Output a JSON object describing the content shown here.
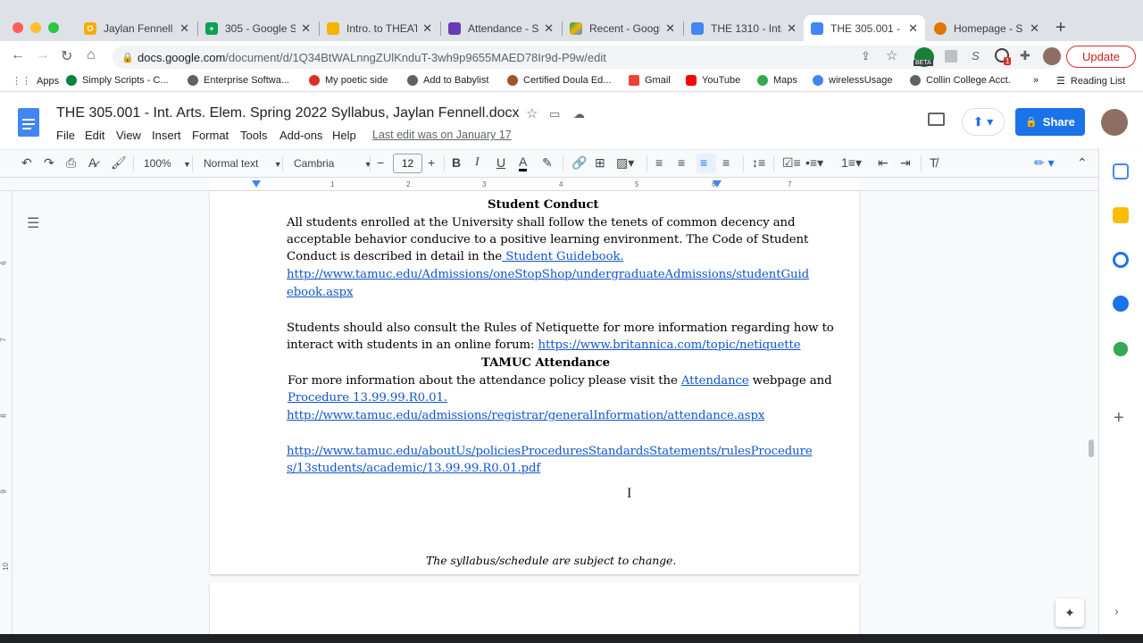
{
  "browser": {
    "tabs": [
      {
        "title": "Jaylan Fennell -",
        "color": "#f9ab00",
        "letter": "O"
      },
      {
        "title": "305 - Google S",
        "color": "#0f9d58",
        "letter": "+"
      },
      {
        "title": "Intro. to THEAT",
        "color": "#f4b400",
        "letter": ""
      },
      {
        "title": "Attendance - S",
        "color": "#673ab7",
        "letter": ""
      },
      {
        "title": "Recent - Googl",
        "color": "#4285f4",
        "letter": ""
      },
      {
        "title": "THE 1310 - Intr",
        "color": "#4285f4",
        "letter": ""
      },
      {
        "title": "THE 305.001 -",
        "color": "#4285f4",
        "letter": ""
      },
      {
        "title": "Homepage - S",
        "color": "#e37400",
        "letter": ""
      }
    ],
    "url_domain": "docs.google.com",
    "url_path": "/document/d/1Q34BtWALnngZUlKnduT-3wh9p9655MAED78Ir9d-P9w/edit",
    "beta_label": "BETA",
    "ext_badge": "1",
    "update_label": "Update",
    "bookmarks": [
      {
        "label": "Apps",
        "color": "#5f6368"
      },
      {
        "label": "Simply Scripts - C...",
        "color": "#0b8043"
      },
      {
        "label": "Enterprise Softwa...",
        "color": "#5f6368"
      },
      {
        "label": "My poetic side",
        "color": "#d93025"
      },
      {
        "label": "Add to Babylist",
        "color": "#5f6368"
      },
      {
        "label": "Certified Doula Ed...",
        "color": "#a0522d"
      },
      {
        "label": "Gmail",
        "color": "#ea4335"
      },
      {
        "label": "YouTube",
        "color": "#ff0000"
      },
      {
        "label": "Maps",
        "color": "#34a853"
      },
      {
        "label": "wirelessUsage",
        "color": "#4285f4"
      },
      {
        "label": "Collin College Acct.",
        "color": "#5f6368"
      }
    ],
    "bookmarks_more": "»",
    "reading_list": "Reading List"
  },
  "docs": {
    "title": "THE 305.001 - Int. Arts. Elem. Spring 2022 Syllabus, Jaylan Fennell.docx",
    "menus": [
      "File",
      "Edit",
      "View",
      "Insert",
      "Format",
      "Tools",
      "Add-ons",
      "Help"
    ],
    "last_edit": "Last edit was on January 17",
    "share_label": "Share",
    "zoom": "100%",
    "style": "Normal text",
    "font": "Cambria",
    "font_size": "12",
    "ruler_numbers": [
      "1",
      "2",
      "3",
      "4",
      "5",
      "6",
      "7"
    ],
    "vruler_numbers": [
      "6",
      "7",
      "8",
      "9",
      "10"
    ]
  },
  "content": {
    "heading_conduct": "Student Conduct",
    "conduct_line1": "All students enrolled at the University shall follow the tenets of common decency and",
    "conduct_line2": "acceptable behavior conducive to a positive learning environment. The Code of Student",
    "conduct_line3_pre": "Conduct is described in detail in the",
    "conduct_line3_link": " Student Guidebook.",
    "guidebook_url1": "http://www.tamuc.edu/Admissions/oneStopShop/undergraduateAdmissions/studentGuid",
    "guidebook_url2": "ebook.aspx",
    "netiquette_line1": "Students should also consult the Rules of Netiquette for more information regarding how to",
    "netiquette_line2_pre": "interact with students in an online forum: ",
    "netiquette_url": "https://www.britannica.com/topic/netiquette",
    "heading_attendance": "TAMUC Attendance",
    "attendance_line1_pre": "For more information about the attendance policy please visit the ",
    "attendance_link": "Attendance",
    "attendance_line1_post": " webpage and",
    "procedure_link": "Procedure 13.99.99.R0.01.",
    "attendance_url": "http://www.tamuc.edu/admissions/registrar/generalInformation/attendance.aspx",
    "procedure_url1": "http://www.tamuc.edu/aboutUs/policiesProceduresStandardsStatements/rulesProcedure",
    "procedure_url2": "s/13students/academic/13.99.99.R0.01.pdf",
    "footer_note": "The syllabus/schedule are subject to change."
  }
}
